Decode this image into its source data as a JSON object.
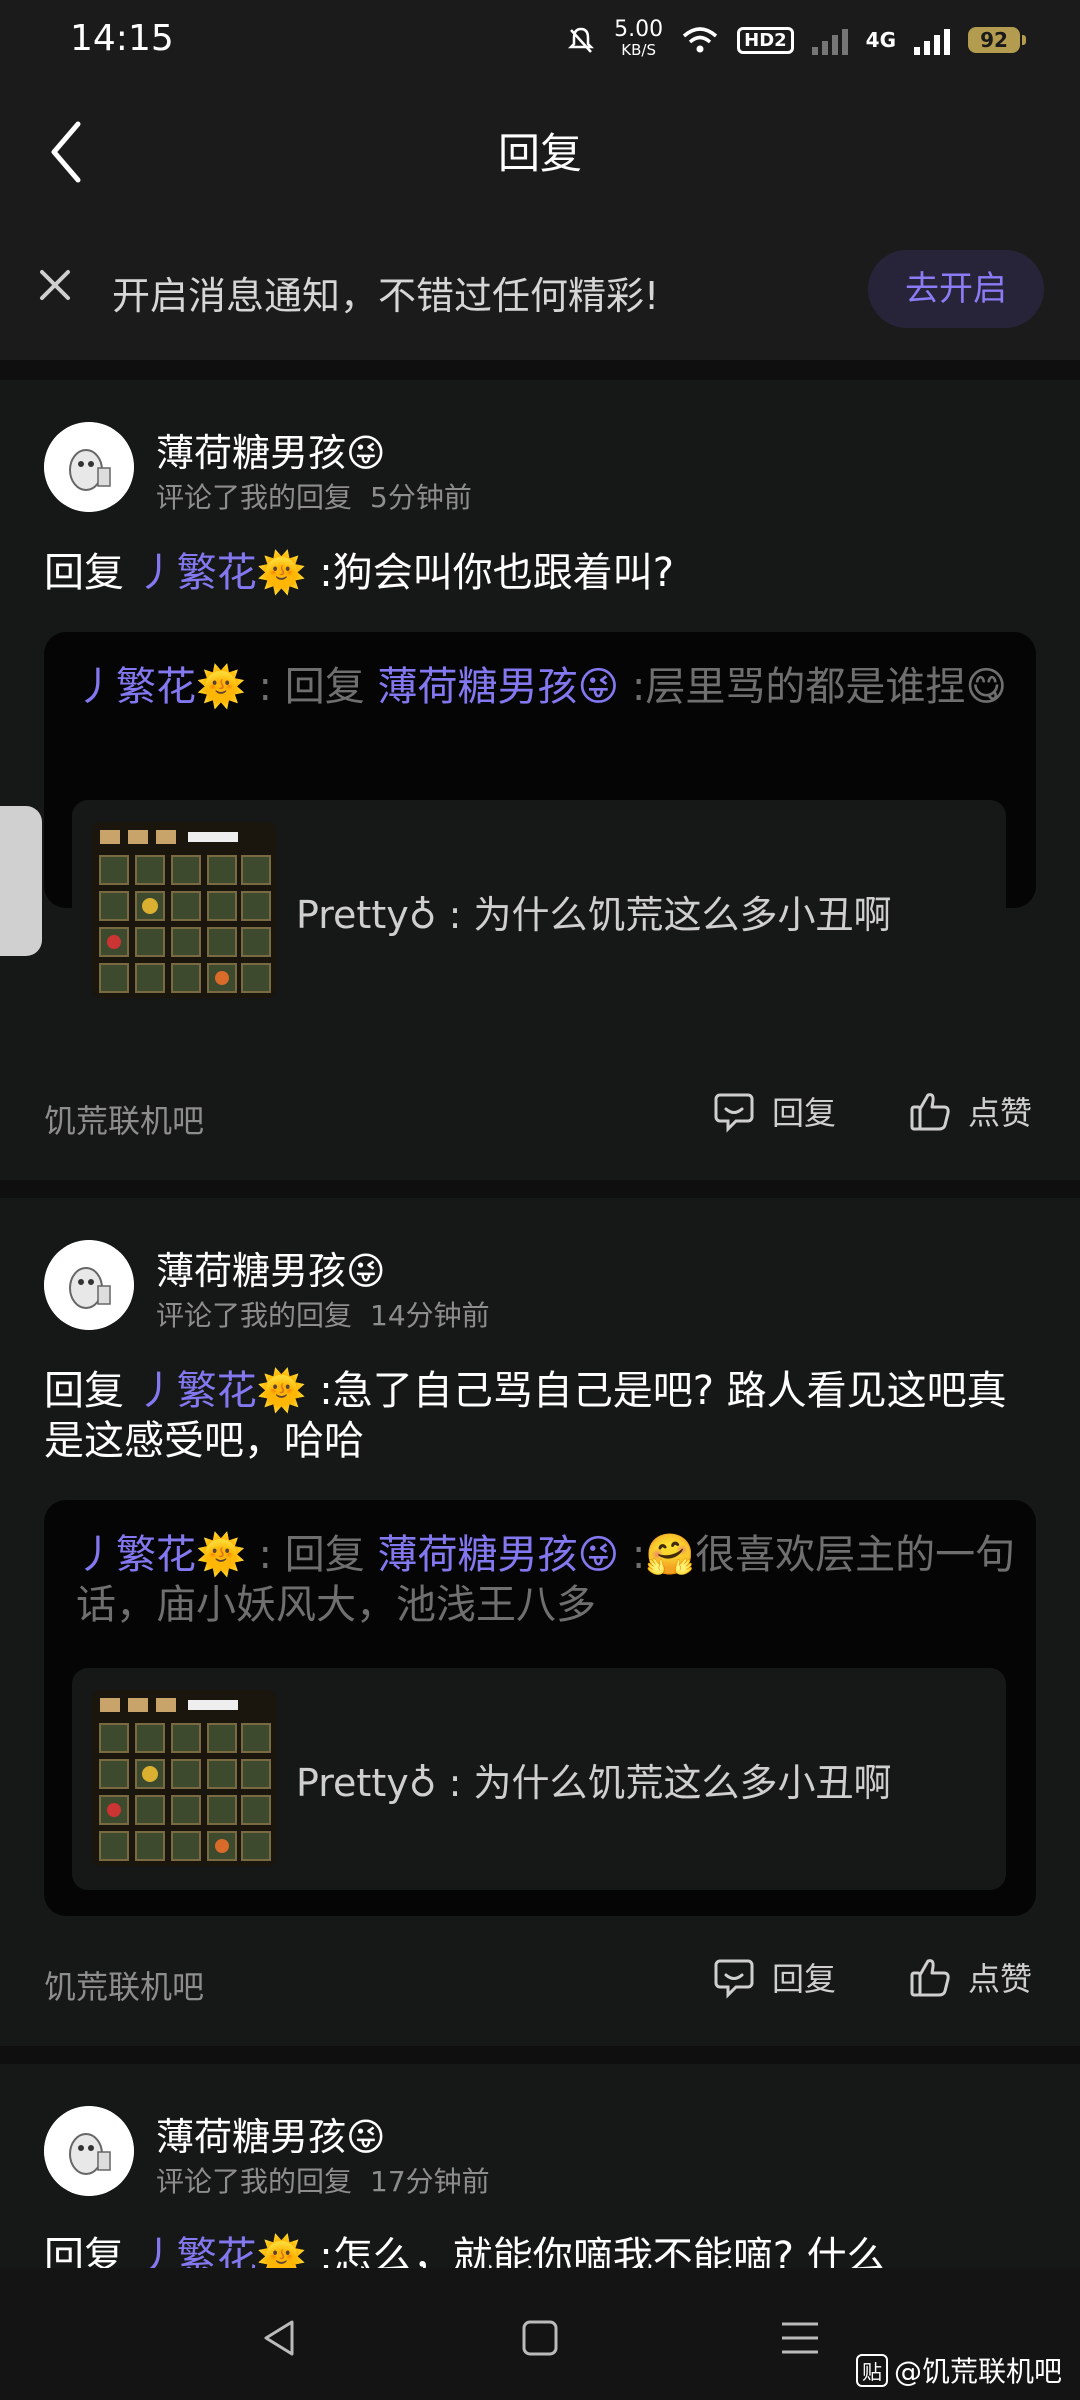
{
  "status": {
    "time": "14:15",
    "net_speed": "5.00",
    "net_unit": "KB/S",
    "hd": "HD2",
    "network": "4G",
    "battery": "92"
  },
  "header": {
    "title": "回复"
  },
  "notice": {
    "text": "开启消息通知，不错过任何精彩!",
    "button": "去开启"
  },
  "cards": [
    {
      "user": "薄荷糖男孩😜",
      "action": "评论了我的回复",
      "time": "5分钟前",
      "reply_prefix": "回复",
      "reply_target": "丿繁花🌞",
      "reply_body": ":狗会叫你也跟着叫?",
      "quote_user": "丿繁花🌞",
      "quote_mid": ": 回复",
      "quote_target": "薄荷糖男孩😜",
      "quote_body": ":层里骂的都是谁捏😋",
      "origin_text": "Pretty♁ : 为什么饥荒这么多小丑啊",
      "forum": "饥荒联机吧",
      "reply_btn": "回复",
      "like_btn": "点赞"
    },
    {
      "user": "薄荷糖男孩😜",
      "action": "评论了我的回复",
      "time": "14分钟前",
      "reply_prefix": "回复",
      "reply_target": "丿繁花🌞",
      "reply_body": ":急了自己骂自己是吧? 路人看见这吧真是这感受吧，哈哈",
      "quote_user": "丿繁花🌞",
      "quote_mid": ": 回复",
      "quote_target": "薄荷糖男孩😜",
      "quote_body": ":🤗很喜欢层主的一句话，庙小妖风大，池浅王八多",
      "origin_text": "Pretty♁ : 为什么饥荒这么多小丑啊",
      "forum": "饥荒联机吧",
      "reply_btn": "回复",
      "like_btn": "点赞"
    },
    {
      "user": "薄荷糖男孩😜",
      "action": "评论了我的回复",
      "time": "17分钟前",
      "reply_prefix": "回复",
      "reply_target": "丿繁花🌞",
      "reply_body": ":怎么，就能你嘀我不能嘀? 什么"
    }
  ],
  "watermark": {
    "icon": "贴",
    "text": "@饥荒联机吧"
  },
  "colors": {
    "accent": "#8478f0",
    "background": "#161817",
    "quote_bg": "#050505"
  }
}
